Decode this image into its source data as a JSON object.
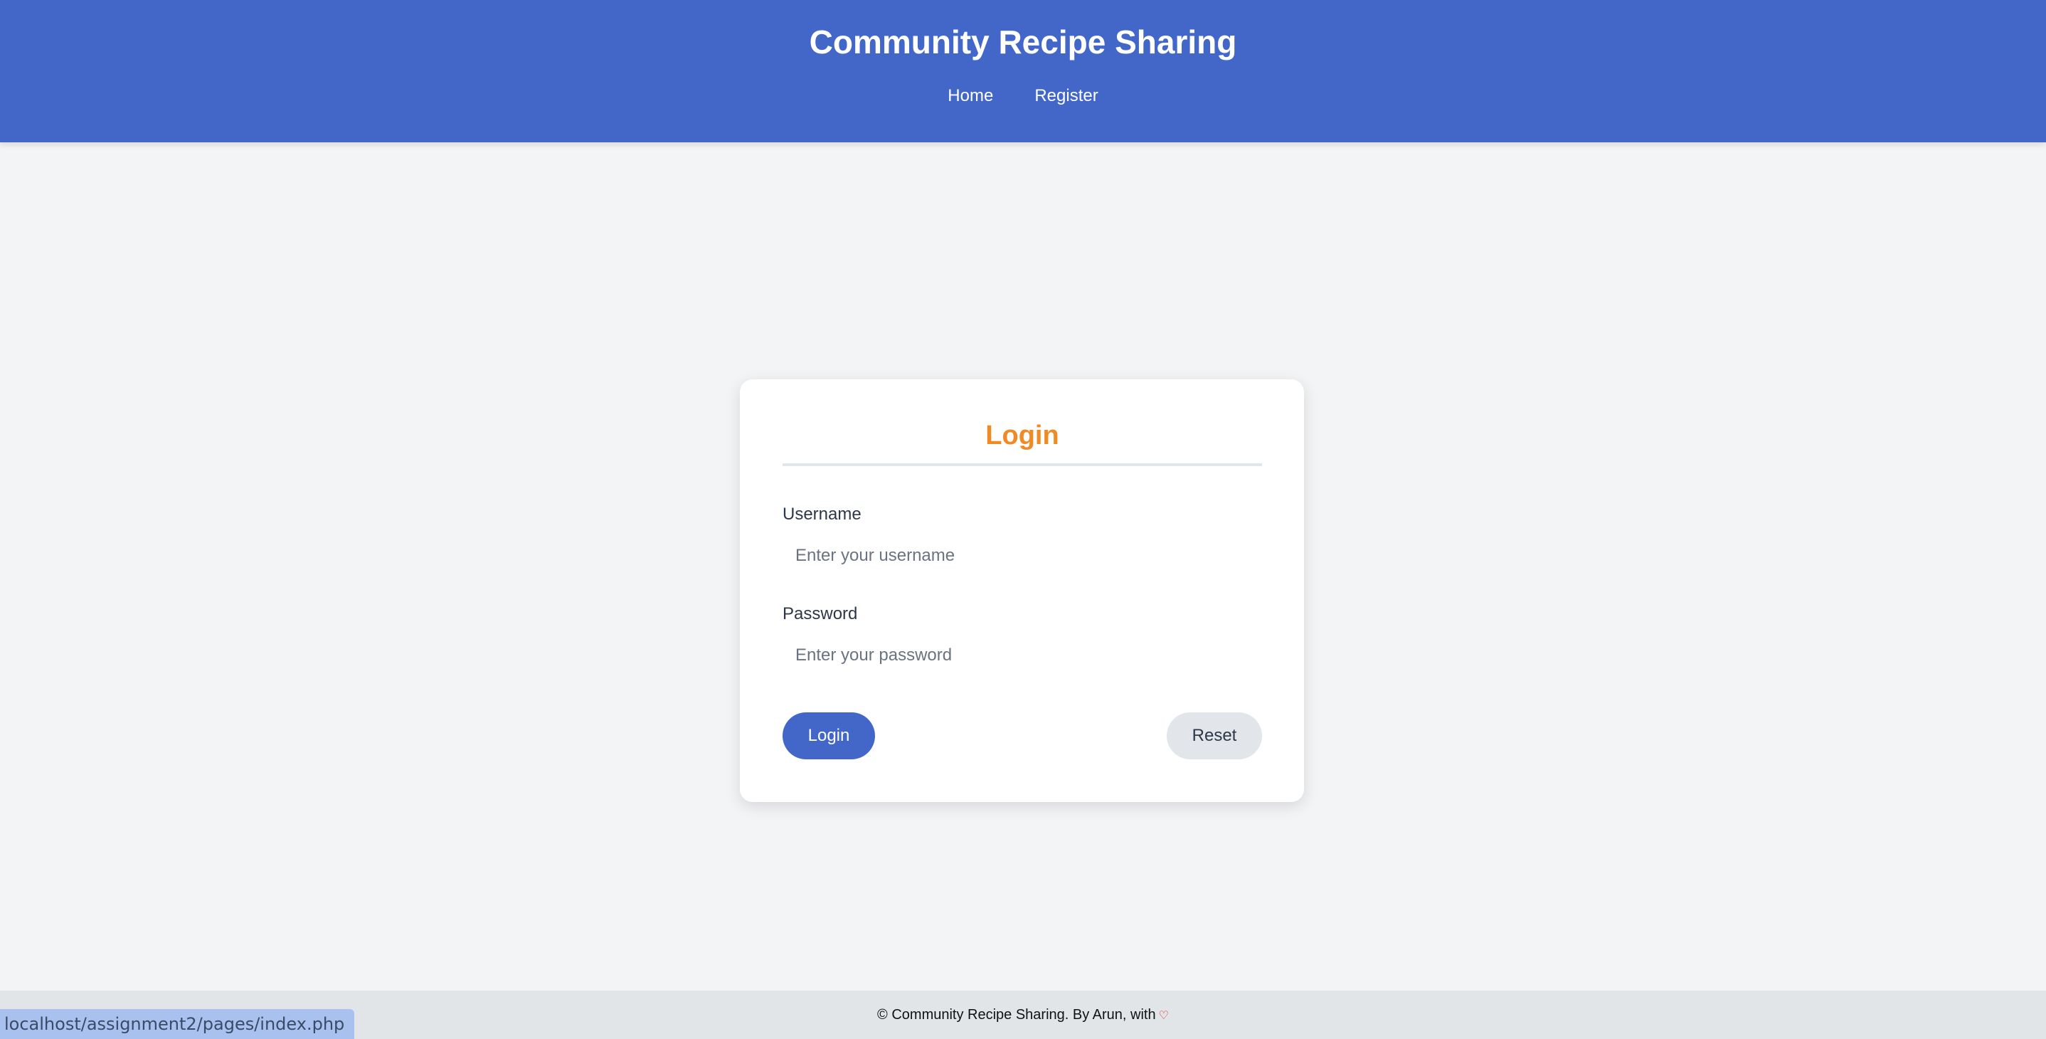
{
  "header": {
    "title": "Community Recipe Sharing",
    "nav": {
      "home": "Home",
      "register": "Register"
    }
  },
  "login_form": {
    "title": "Login",
    "username": {
      "label": "Username",
      "placeholder": "Enter your username",
      "value": ""
    },
    "password": {
      "label": "Password",
      "placeholder": "Enter your password",
      "value": ""
    },
    "login_button": "Login",
    "reset_button": "Reset"
  },
  "footer": {
    "text": "© Community Recipe Sharing. By Arun, with",
    "heart_icon": "heart-icon",
    "heart_glyph": "♡"
  },
  "status_bar": {
    "url": "localhost/assignment2/pages/index.php"
  },
  "colors": {
    "brand_blue": "#4267c8",
    "title_orange": "#f08a24",
    "heart_red": "#e02424"
  }
}
